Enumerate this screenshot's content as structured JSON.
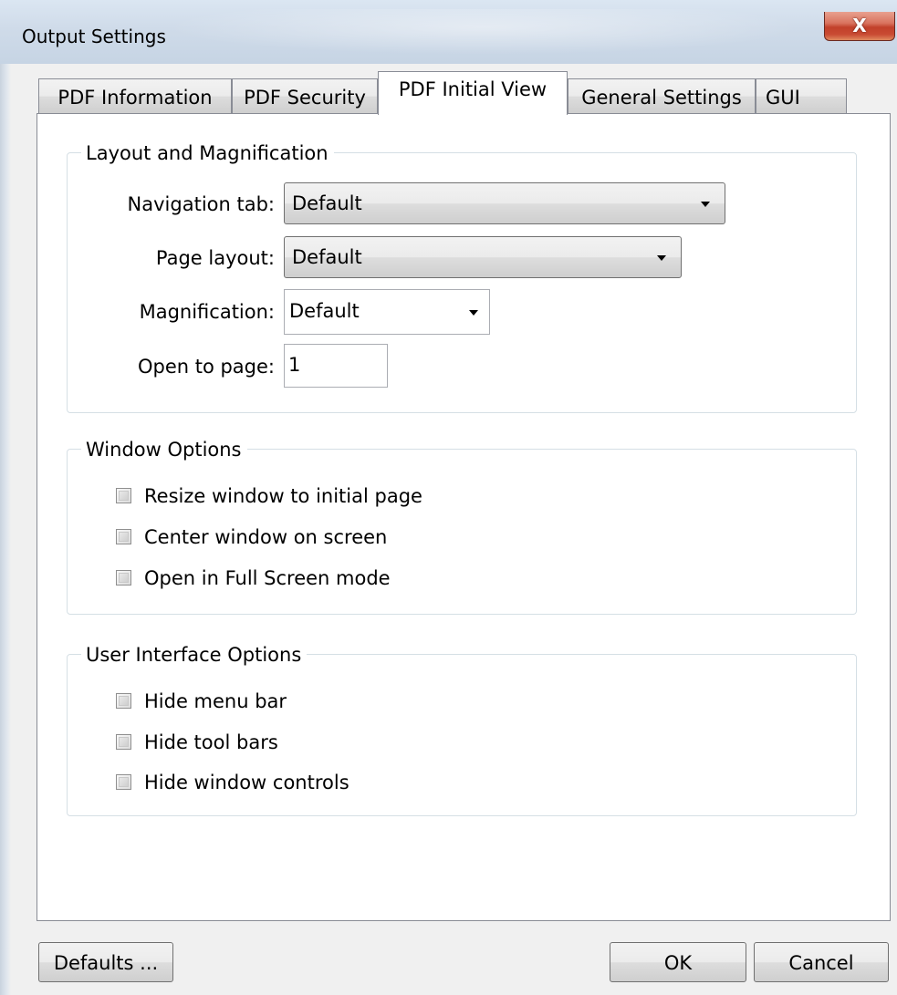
{
  "window": {
    "title": "Output Settings",
    "close_glyph": "X"
  },
  "tabs": [
    {
      "label": "PDF Information",
      "active": false
    },
    {
      "label": "PDF Security",
      "active": false
    },
    {
      "label": "PDF Initial View",
      "active": true
    },
    {
      "label": "General Settings",
      "active": false
    },
    {
      "label": "GUI",
      "active": false
    }
  ],
  "layout_group": {
    "title": "Layout and Magnification",
    "navigation_tab": {
      "label": "Navigation tab:",
      "value": "Default"
    },
    "page_layout": {
      "label": "Page layout:",
      "value": "Default"
    },
    "magnification": {
      "label": "Magnification:",
      "value": "Default"
    },
    "open_to_page": {
      "label": "Open to page:",
      "value": "1"
    }
  },
  "window_group": {
    "title": "Window Options",
    "options": [
      {
        "label": "Resize window to initial page",
        "checked": false
      },
      {
        "label": "Center window on screen",
        "checked": false
      },
      {
        "label": "Open in Full Screen mode",
        "checked": false
      }
    ]
  },
  "ui_group": {
    "title": "User Interface Options",
    "options": [
      {
        "label": "Hide menu bar",
        "checked": false
      },
      {
        "label": "Hide tool bars",
        "checked": false
      },
      {
        "label": "Hide window controls",
        "checked": false
      }
    ]
  },
  "buttons": {
    "defaults": "Defaults ...",
    "ok": "OK",
    "cancel": "Cancel"
  },
  "icons": [
    "close-icon",
    "chevron-down-icon",
    "checkbox-icon"
  ]
}
